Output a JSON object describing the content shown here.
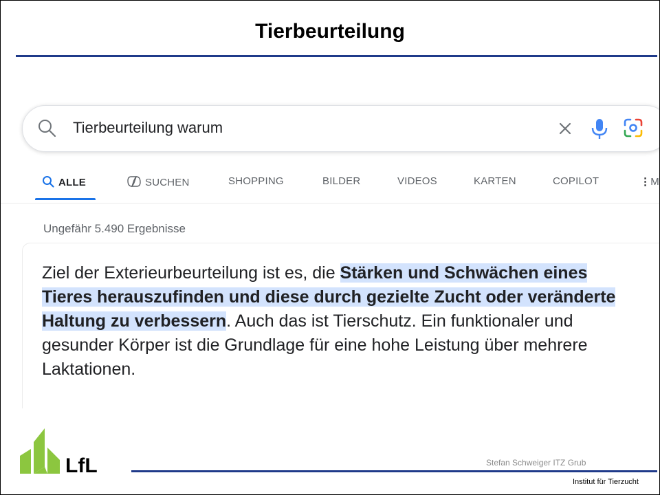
{
  "slide": {
    "title": "Tierbeurteilung",
    "author": "Stefan Schweiger ITZ Grub",
    "institute": "Institut für Tierzucht",
    "logo_text": "LfL"
  },
  "search": {
    "query": "Tierbeurteilung warum",
    "icons": [
      "search-icon",
      "clear-icon",
      "microphone-icon",
      "lens-icon"
    ]
  },
  "tabs": [
    {
      "label": "ALLE",
      "active": true
    },
    {
      "label": "SUCHEN"
    },
    {
      "label": "SHOPPING"
    },
    {
      "label": "BILDER"
    },
    {
      "label": "VIDEOS"
    },
    {
      "label": "KARTEN"
    },
    {
      "label": "COPILOT"
    },
    {
      "label": "M"
    }
  ],
  "results": {
    "count_text": "Ungefähr 5.490 Ergebnisse",
    "snippet_before": "Ziel der Exterieurbeurteilung ist es, die ",
    "snippet_highlight": "Stärken und Schwächen eines Tieres herauszufinden und diese durch gezielte Zucht oder veränderte Haltung zu verbessern",
    "snippet_after": ". Auch das ist Tierschutz. Ein funktionaler und gesunder Körper ist die Grundlage für eine hohe Leistung über mehrere Laktationen."
  },
  "colors": {
    "accent_blue": "#1a73e8",
    "rule_blue": "#1f3a8a",
    "highlight": "#d3e3fd",
    "logo_green": "#8cc63f"
  }
}
